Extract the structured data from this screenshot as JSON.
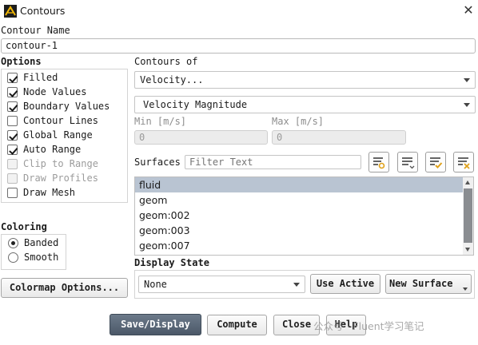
{
  "window": {
    "title": "Contours",
    "icon": "ansys-app-icon",
    "close_label": "✕"
  },
  "contour_name": {
    "label": "Contour Name",
    "value": "contour-1"
  },
  "options": {
    "label": "Options",
    "items": [
      {
        "label": "Filled",
        "checked": true,
        "enabled": true
      },
      {
        "label": "Node Values",
        "checked": true,
        "enabled": true
      },
      {
        "label": "Boundary Values",
        "checked": true,
        "enabled": true
      },
      {
        "label": "Contour Lines",
        "checked": false,
        "enabled": true
      },
      {
        "label": "Global Range",
        "checked": true,
        "enabled": true
      },
      {
        "label": "Auto Range",
        "checked": true,
        "enabled": true
      },
      {
        "label": "Clip to Range",
        "checked": false,
        "enabled": false
      },
      {
        "label": "Draw Profiles",
        "checked": false,
        "enabled": false
      },
      {
        "label": "Draw Mesh",
        "checked": false,
        "enabled": true
      }
    ]
  },
  "contours_of": {
    "label": "Contours of",
    "primary": "Velocity...",
    "secondary": "Velocity Magnitude"
  },
  "range": {
    "min_label": "Min [m/s]",
    "min_value": "0",
    "max_label": "Max [m/s]",
    "max_value": "0"
  },
  "surfaces": {
    "label": "Surfaces",
    "filter_placeholder": "Filter Text",
    "items": [
      "fluid",
      "geom",
      "geom:002",
      "geom:003",
      "geom:007"
    ],
    "selected": "fluid"
  },
  "coloring": {
    "label": "Coloring",
    "options": [
      "Banded",
      "Smooth"
    ],
    "selected": "Banded"
  },
  "colormap_button": "Colormap Options...",
  "display_state": {
    "label": "Display State",
    "value": "None",
    "use_active": "Use Active",
    "new_surface": "New Surface"
  },
  "actions": {
    "save_display": "Save/Display",
    "compute": "Compute",
    "close": "Close",
    "help": "Help"
  },
  "watermark": "公众号 · Fluent学习笔记",
  "colors": {
    "primary_button": "#56636f",
    "selected_row": "#b9c4d2",
    "icon_accent": "#e0a21b"
  }
}
